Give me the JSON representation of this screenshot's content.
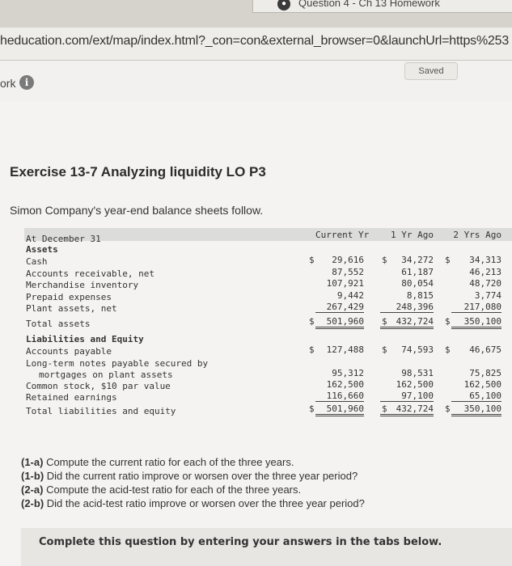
{
  "browser": {
    "tab_title": "Question 4 - Ch 13 Homework",
    "url": "heducation.com/ext/map/index.html?_con=con&external_browser=0&launchUrl=https%253"
  },
  "header": {
    "nav_label": "ork",
    "info_glyph": "i",
    "saved_label": "Saved"
  },
  "exercise": {
    "title": "Exercise 13-7 Analyzing liquidity LO P3",
    "intro": "Simon Company's year-end balance sheets follow."
  },
  "table": {
    "header_label": "At December 31",
    "columns": [
      "Current Yr",
      "1 Yr Ago",
      "2 Yrs Ago"
    ],
    "assets_heading": "Assets",
    "rows_assets": [
      {
        "label": "Cash",
        "v": [
          "29,616",
          "34,272",
          "34,313"
        ],
        "dollar": true
      },
      {
        "label": "Accounts receivable, net",
        "v": [
          "87,552",
          "61,187",
          "46,213"
        ]
      },
      {
        "label": "Merchandise inventory",
        "v": [
          "107,921",
          "80,054",
          "48,720"
        ]
      },
      {
        "label": "Prepaid expenses",
        "v": [
          "9,442",
          "8,815",
          "3,774"
        ]
      },
      {
        "label": "Plant assets, net",
        "v": [
          "267,429",
          "248,396",
          "217,080"
        ]
      }
    ],
    "total_assets": {
      "label": "Total assets",
      "v": [
        "501,960",
        "432,724",
        "350,100"
      ]
    },
    "liab_heading": "Liabilities and Equity",
    "accounts_payable": {
      "label": "Accounts payable",
      "v": [
        "127,488",
        "74,593",
        "46,675"
      ]
    },
    "ltnotes_label_1": "Long-term notes payable secured by",
    "ltnotes": {
      "label": "mortgages on plant assets",
      "v": [
        "95,312",
        "98,531",
        "75,825"
      ]
    },
    "common_stock": {
      "label": "Common stock, $10 par value",
      "v": [
        "162,500",
        "162,500",
        "162,500"
      ]
    },
    "retained": {
      "label": "Retained earnings",
      "v": [
        "116,660",
        "97,100",
        "65,100"
      ]
    },
    "total_le": {
      "label": "Total liabilities and equity",
      "v": [
        "501,960",
        "432,724",
        "350,100"
      ]
    },
    "dollar_sign": "$"
  },
  "questions": [
    {
      "tag": "(1-a)",
      "text": " Compute the current ratio for each of the three years."
    },
    {
      "tag": "(1-b)",
      "text": " Did the current ratio improve or worsen over the three year period?"
    },
    {
      "tag": "(2-a)",
      "text": " Compute the acid-test ratio for each of the three years."
    },
    {
      "tag": "(2-b)",
      "text": " Did the acid-test ratio improve or worsen over the three year period?"
    }
  ],
  "instruction": "Complete this question by entering your answers in the tabs below."
}
